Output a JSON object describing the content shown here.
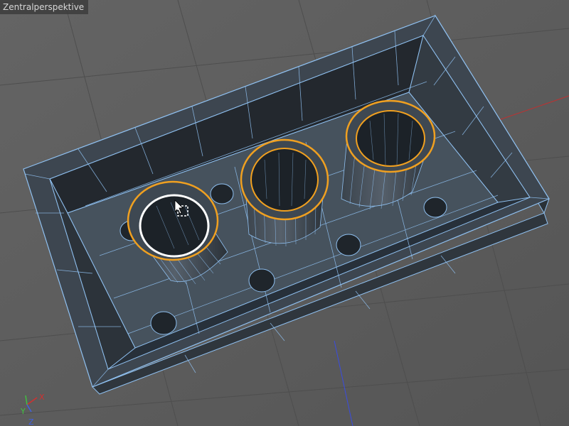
{
  "viewport": {
    "camera_label": "Zentralperspektive"
  },
  "axes": {
    "x_label": "X",
    "y_label": "Y",
    "z_label": "Z",
    "x_color": "#d03030",
    "y_color": "#40c040",
    "z_color": "#4060e0"
  },
  "colors": {
    "background": "#5d5d5d",
    "wire": "#8fc0f0",
    "selection": "#f0a020",
    "active_selection": "#ffffff"
  },
  "icons": {
    "cursor": "move-cursor-icon"
  }
}
